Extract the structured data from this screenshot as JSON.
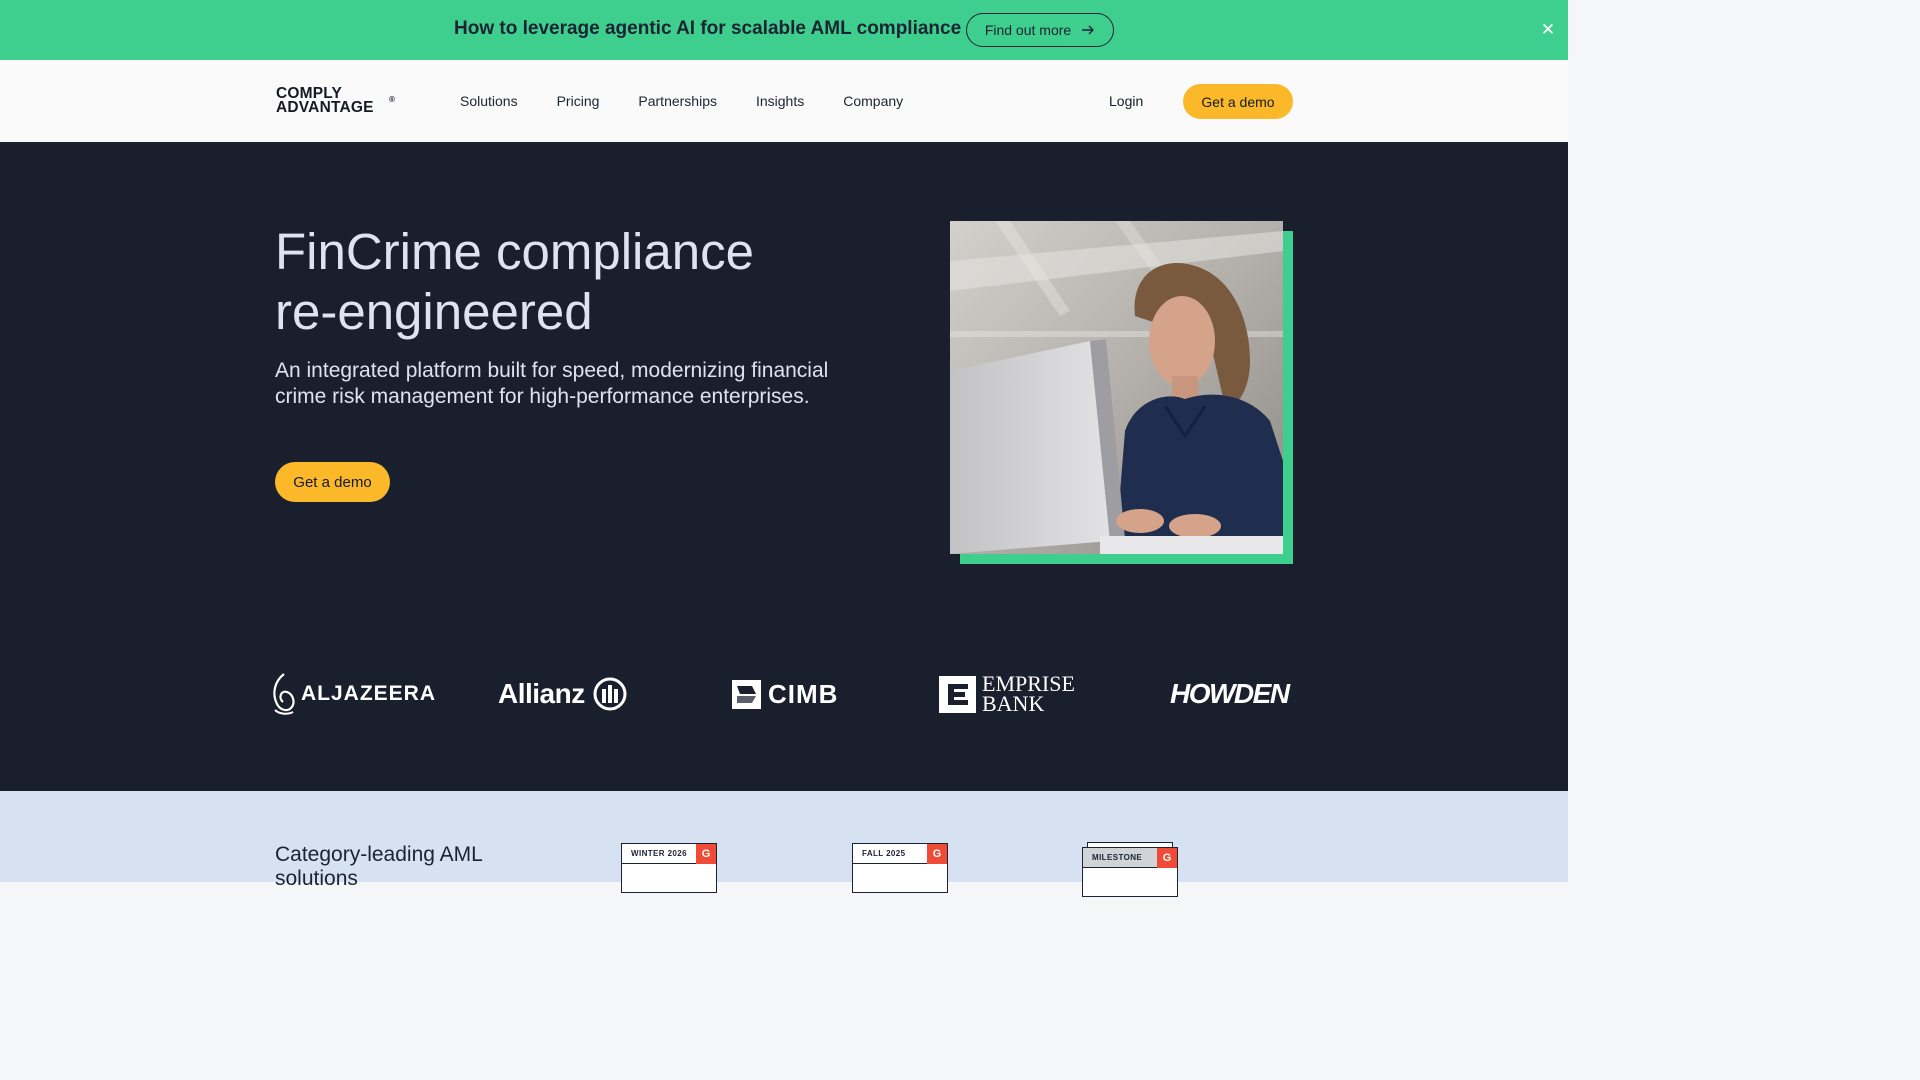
{
  "banner": {
    "text": "How to leverage agentic AI for scalable AML compliance",
    "button_label": "Find out more",
    "arrow_icon": "arrow-right-icon",
    "close_icon": "close-icon",
    "close_glyph": "✕",
    "background": "#3ecf8e"
  },
  "nav": {
    "logo_line1": "COMPLY",
    "logo_line2": "ADVANTAGE",
    "logo_reg": "®",
    "links": [
      "Solutions",
      "Pricing",
      "Partnerships",
      "Insights",
      "Company"
    ],
    "login_label": "Login",
    "demo_label": "Get a demo"
  },
  "hero": {
    "title_line1": "FinCrime compliance",
    "title_line2": "re-engineered",
    "subtitle": "An integrated platform built for speed, modernizing financial crime risk management for high-performance enterprises.",
    "demo_label": "Get a demo",
    "background": "#1a1f2e",
    "accent": "#3ecf8e",
    "cta_color": "#fbb92a"
  },
  "clients": {
    "aljazeera": "ALJAZEERA",
    "allianz": "Allianz",
    "cimb": "CIMB",
    "emprise_line1": "EMPRISE",
    "emprise_line2": "BANK",
    "howden": "HOWDEN"
  },
  "awards": {
    "title": "Category-leading AML solutions",
    "badges": [
      {
        "label": "WINTER 2026",
        "g2": "G"
      },
      {
        "label": "FALL 2025",
        "g2": "G"
      },
      {
        "label": "MILESTONE",
        "g2": "G"
      }
    ]
  }
}
